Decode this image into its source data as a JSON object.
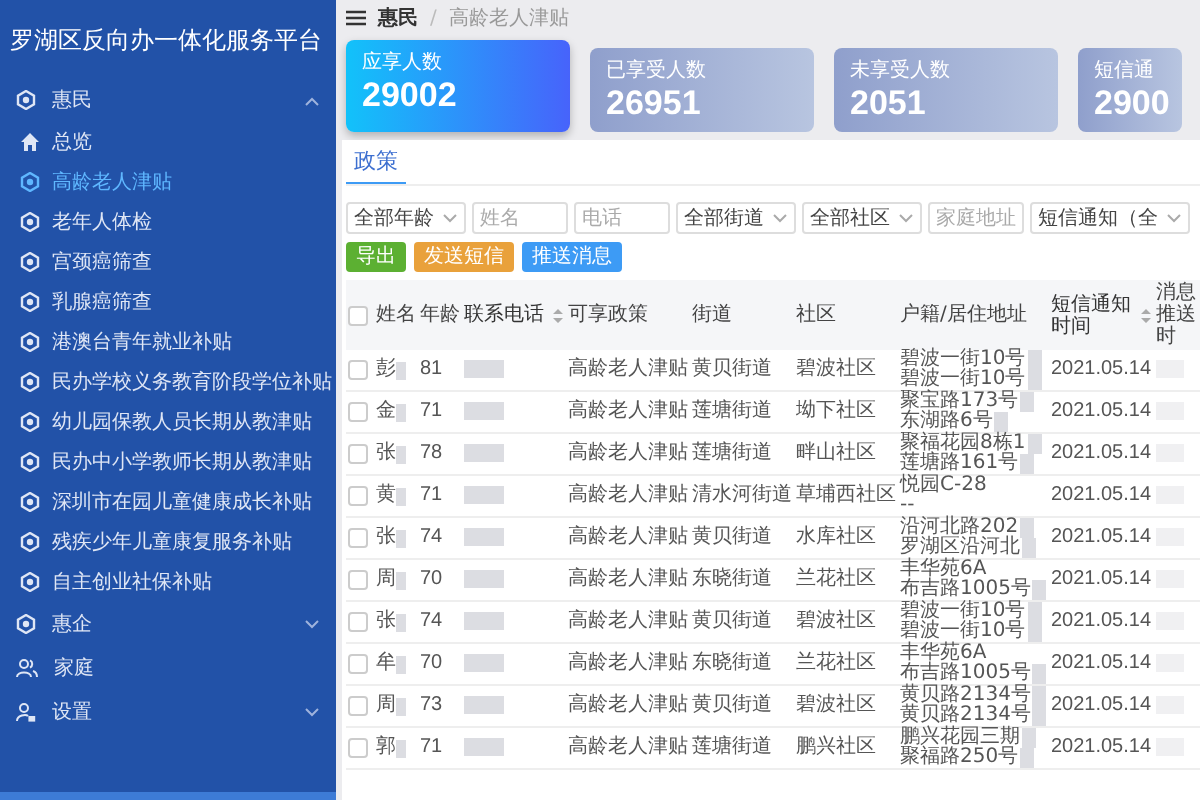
{
  "sidebar": {
    "title": "罗湖区反向办一体化服务平台",
    "groups": [
      {
        "label": "惠民",
        "kind": "group",
        "expanded": true,
        "children": [
          {
            "label": "总览",
            "kind": "overview",
            "selected": false
          },
          {
            "label": "高龄老人津贴",
            "kind": "policy",
            "selected": true
          },
          {
            "label": "老年人体检",
            "kind": "policy",
            "selected": false
          },
          {
            "label": "宫颈癌筛查",
            "kind": "policy",
            "selected": false
          },
          {
            "label": "乳腺癌筛查",
            "kind": "policy",
            "selected": false
          },
          {
            "label": "港澳台青年就业补贴",
            "kind": "policy",
            "selected": false
          },
          {
            "label": "民办学校义务教育阶段学位补贴",
            "kind": "policy",
            "selected": false
          },
          {
            "label": "幼儿园保教人员长期从教津贴",
            "kind": "policy",
            "selected": false
          },
          {
            "label": "民办中小学教师长期从教津贴",
            "kind": "policy",
            "selected": false
          },
          {
            "label": "深圳市在园儿童健康成长补贴",
            "kind": "policy",
            "selected": false
          },
          {
            "label": "残疾少年儿童康复服务补贴",
            "kind": "policy",
            "selected": false
          },
          {
            "label": "自主创业社保补贴",
            "kind": "policy",
            "selected": false
          }
        ]
      },
      {
        "label": "惠企",
        "kind": "group",
        "expanded": false
      },
      {
        "label": "家庭",
        "kind": "family"
      },
      {
        "label": "设置",
        "kind": "settings",
        "expanded": false
      }
    ]
  },
  "breadcrumb": [
    "惠民",
    "高龄老人津贴"
  ],
  "breadcrumb_separator": "/",
  "stats": [
    {
      "label": "应享人数",
      "value": "29002",
      "selected": true
    },
    {
      "label": "已享受人数",
      "value": "26951",
      "selected": false
    },
    {
      "label": "未享受人数",
      "value": "2051",
      "selected": false
    },
    {
      "label": "短信通",
      "value": "2900",
      "selected": false
    }
  ],
  "tabs": [
    {
      "label": "政策",
      "selected": true
    }
  ],
  "filters": [
    {
      "kind": "select",
      "value": "全部年龄"
    },
    {
      "kind": "input",
      "placeholder": "姓名"
    },
    {
      "kind": "input",
      "placeholder": "电话"
    },
    {
      "kind": "select",
      "value": "全部街道"
    },
    {
      "kind": "select",
      "value": "全部社区"
    },
    {
      "kind": "input",
      "placeholder": "家庭地址"
    },
    {
      "kind": "select",
      "value": "短信通知（全"
    }
  ],
  "buttons": [
    {
      "label": "导出",
      "color": "#5cb032"
    },
    {
      "label": "发送短信",
      "color": "#e9a13b"
    },
    {
      "label": "推送消息",
      "color": "#3d9bf5"
    }
  ],
  "table": {
    "header_checked": false,
    "columns": [
      {
        "label": "姓名",
        "sortable": false
      },
      {
        "label": "年龄",
        "sortable": false
      },
      {
        "label": "联系电话",
        "sortable": true
      },
      {
        "label": "可享政策",
        "sortable": false
      },
      {
        "label": "街道",
        "sortable": false
      },
      {
        "label": "社区",
        "sortable": false
      },
      {
        "label": "户籍/居住地址",
        "sortable": false
      },
      {
        "label": "短信通知时间",
        "sortable": true
      },
      {
        "label": "消息推送时",
        "sortable": false
      }
    ],
    "rows": [
      {
        "checked": false,
        "name": "彭",
        "age": "81",
        "policy": "高龄老人津贴",
        "street": "黄贝街道",
        "community": "碧波社区",
        "address": [
          {
            "text": "碧波一街10号",
            "blurred": true
          },
          {
            "text": "碧波一街10号",
            "blurred": true
          }
        ],
        "sms_time": "2021.05.14"
      },
      {
        "checked": false,
        "name": "金",
        "age": "71",
        "policy": "高龄老人津贴",
        "street": "莲塘街道",
        "community": "坳下社区",
        "address": [
          {
            "text": "聚宝路173号",
            "blurred": true
          },
          {
            "text": "东湖路6号",
            "blurred": true
          }
        ],
        "sms_time": "2021.05.14"
      },
      {
        "checked": false,
        "name": "张",
        "age": "78",
        "policy": "高龄老人津贴",
        "street": "莲塘街道",
        "community": "畔山社区",
        "address": [
          {
            "text": "聚福花园8栋1",
            "blurred": true
          },
          {
            "text": "莲塘路161号",
            "blurred": true
          }
        ],
        "sms_time": "2021.05.14"
      },
      {
        "checked": false,
        "name": "黄",
        "age": "71",
        "policy": "高龄老人津贴",
        "street": "清水河街道",
        "community": "草埔西社区",
        "address": [
          {
            "text": "悦园C-28",
            "blurred": false
          },
          {
            "text": "--",
            "blurred": false
          }
        ],
        "sms_time": "2021.05.14"
      },
      {
        "checked": false,
        "name": "张",
        "age": "74",
        "policy": "高龄老人津贴",
        "street": "黄贝街道",
        "community": "水库社区",
        "address": [
          {
            "text": "沿河北路202",
            "blurred": true
          },
          {
            "text": "罗湖区沿河北",
            "blurred": true
          }
        ],
        "sms_time": "2021.05.14"
      },
      {
        "checked": false,
        "name": "周",
        "age": "70",
        "policy": "高龄老人津贴",
        "street": "东晓街道",
        "community": "兰花社区",
        "address": [
          {
            "text": "丰华苑6A",
            "blurred": false
          },
          {
            "text": "布吉路1005号",
            "blurred": true
          }
        ],
        "sms_time": "2021.05.14"
      },
      {
        "checked": false,
        "name": "张",
        "age": "74",
        "policy": "高龄老人津贴",
        "street": "黄贝街道",
        "community": "碧波社区",
        "address": [
          {
            "text": "碧波一街10号",
            "blurred": true
          },
          {
            "text": "碧波一街10号",
            "blurred": true
          }
        ],
        "sms_time": "2021.05.14"
      },
      {
        "checked": false,
        "name": "牟",
        "age": "70",
        "policy": "高龄老人津贴",
        "street": "东晓街道",
        "community": "兰花社区",
        "address": [
          {
            "text": "丰华苑6A",
            "blurred": false
          },
          {
            "text": "布吉路1005号",
            "blurred": true
          }
        ],
        "sms_time": "2021.05.14"
      },
      {
        "checked": false,
        "name": "周",
        "age": "73",
        "policy": "高龄老人津贴",
        "street": "黄贝街道",
        "community": "碧波社区",
        "address": [
          {
            "text": "黄贝路2134号",
            "blurred": true
          },
          {
            "text": "黄贝路2134号",
            "blurred": true
          }
        ],
        "sms_time": "2021.05.14"
      },
      {
        "checked": false,
        "name": "郭",
        "age": "71",
        "policy": "高龄老人津贴",
        "street": "莲塘街道",
        "community": "鹏兴社区",
        "address": [
          {
            "text": "鹏兴花园三期",
            "blurred": true
          },
          {
            "text": "聚福路250号",
            "blurred": true
          }
        ],
        "sms_time": "2021.05.14"
      }
    ]
  }
}
